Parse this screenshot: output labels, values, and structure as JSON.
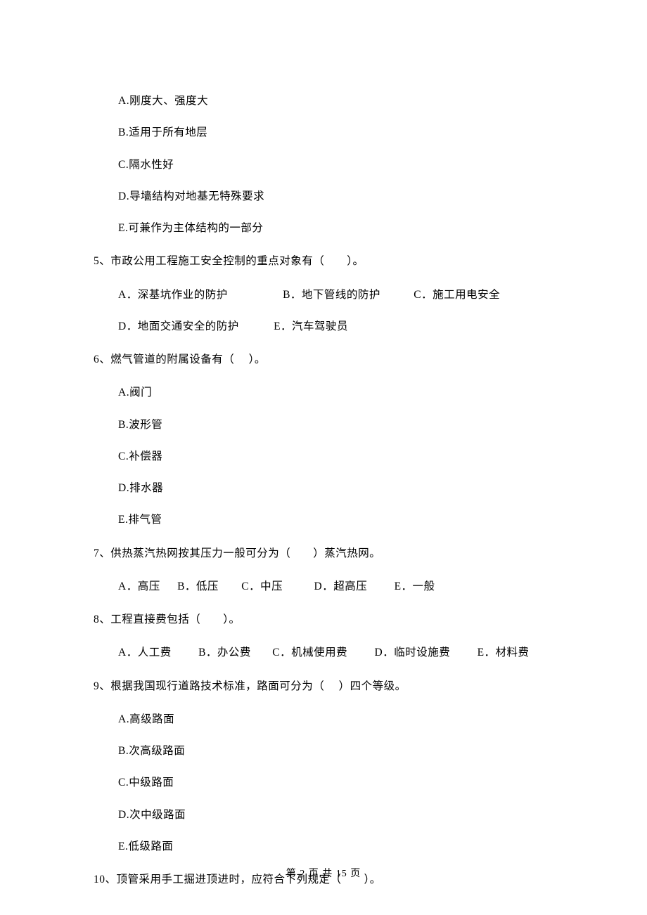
{
  "q4": {
    "optA": "A.刚度大、强度大",
    "optB": "B.适用于所有地层",
    "optC": "C.隔水性好",
    "optD": "D.导墙结构对地基无特殊要求",
    "optE": "E.可兼作为主体结构的一部分"
  },
  "q5": {
    "stem": "5、市政公用工程施工安全控制的重点对象有（　　）。",
    "optA": "A．深基坑作业的防护",
    "optB": "B．地下管线的防护",
    "optC": "C．施工用电安全",
    "optD": "D．地面交通安全的防护",
    "optE": "E．汽车驾驶员"
  },
  "q6": {
    "stem": "6、燃气管道的附属设备有（　 ）。",
    "optA": "A.阀门",
    "optB": "B.波形管",
    "optC": "C.补偿器",
    "optD": "D.排水器",
    "optE": "E.排气管"
  },
  "q7": {
    "stem": "7、供热蒸汽热网按其压力一般可分为（　　）蒸汽热网。",
    "optA": "A．高压",
    "optB": "B．低压",
    "optC": "C．中压",
    "optD": "D．超高压",
    "optE": "E．一般"
  },
  "q8": {
    "stem": "8、工程直接费包括（　　）。",
    "optA": "A．人工费",
    "optB": "B．办公费",
    "optC": "C．机械使用费",
    "optD": "D．临时设施费",
    "optE": "E．材料费"
  },
  "q9": {
    "stem": "9、根据我国现行道路技术标准，路面可分为（　 ）四个等级。",
    "optA": "A.高级路面",
    "optB": "B.次高级路面",
    "optC": "C.中级路面",
    "optD": "D.次中级路面",
    "optE": "E.低级路面"
  },
  "q10": {
    "stem": "10、顶管采用手工掘进顶进时，应符合下列规定（　　）。"
  },
  "footer": "第 2 页 共 15 页"
}
